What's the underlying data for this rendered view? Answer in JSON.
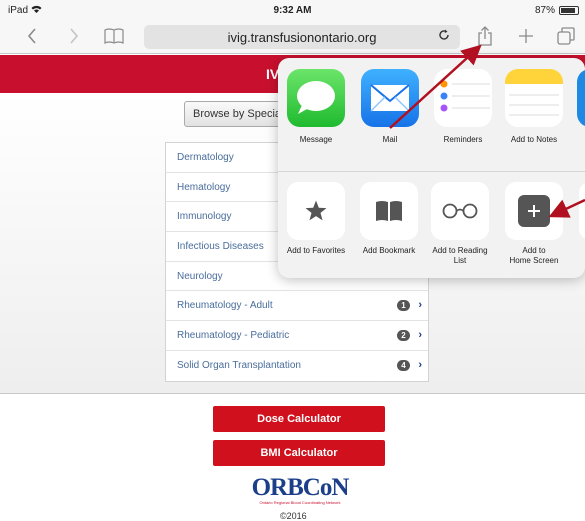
{
  "status": {
    "device": "iPad",
    "time": "9:32 AM",
    "battery_text": "87%",
    "battery_level": 0.87
  },
  "browser": {
    "url": "ivig.transfusionontario.org"
  },
  "header": {
    "title_fragment": "IV"
  },
  "browse": {
    "label": "Browse by Specia"
  },
  "specialties": [
    {
      "label": "Dermatology",
      "badge": ""
    },
    {
      "label": "Hematology",
      "badge": ""
    },
    {
      "label": "Immunology",
      "badge": ""
    },
    {
      "label": "Infectious Diseases",
      "badge": ""
    },
    {
      "label": "Neurology",
      "badge": ""
    },
    {
      "label": "Rheumatology - Adult",
      "badge": "1"
    },
    {
      "label": "Rheumatology - Pediatric",
      "badge": "2"
    },
    {
      "label": "Solid Organ Transplantation",
      "badge": "4"
    }
  ],
  "buttons": {
    "dose": "Dose Calculator",
    "bmi": "BMI Calculator"
  },
  "footer": {
    "logo": "ORBCoN",
    "tagline": "Ontario Regional Blood Coordinating Network",
    "copyright": "©2016"
  },
  "share_apps": [
    {
      "label": "Message",
      "icon": "message-icon"
    },
    {
      "label": "Mail",
      "icon": "mail-icon"
    },
    {
      "label": "Reminders",
      "icon": "reminders-icon"
    },
    {
      "label": "Add to Notes",
      "icon": "notes-icon"
    }
  ],
  "share_actions": [
    {
      "line1": "Add to Favorites",
      "line2": "",
      "icon": "star-icon"
    },
    {
      "line1": "Add Bookmark",
      "line2": "",
      "icon": "book-icon"
    },
    {
      "line1": "Add to Reading",
      "line2": "List",
      "icon": "glasses-icon"
    },
    {
      "line1": "Add to",
      "line2": "Home Screen",
      "icon": "plus-icon"
    }
  ],
  "colors": {
    "brand_red": "#c8102e",
    "button_red": "#d0101c",
    "link_blue": "#4a6d9c",
    "annotation_red": "#b01020"
  }
}
